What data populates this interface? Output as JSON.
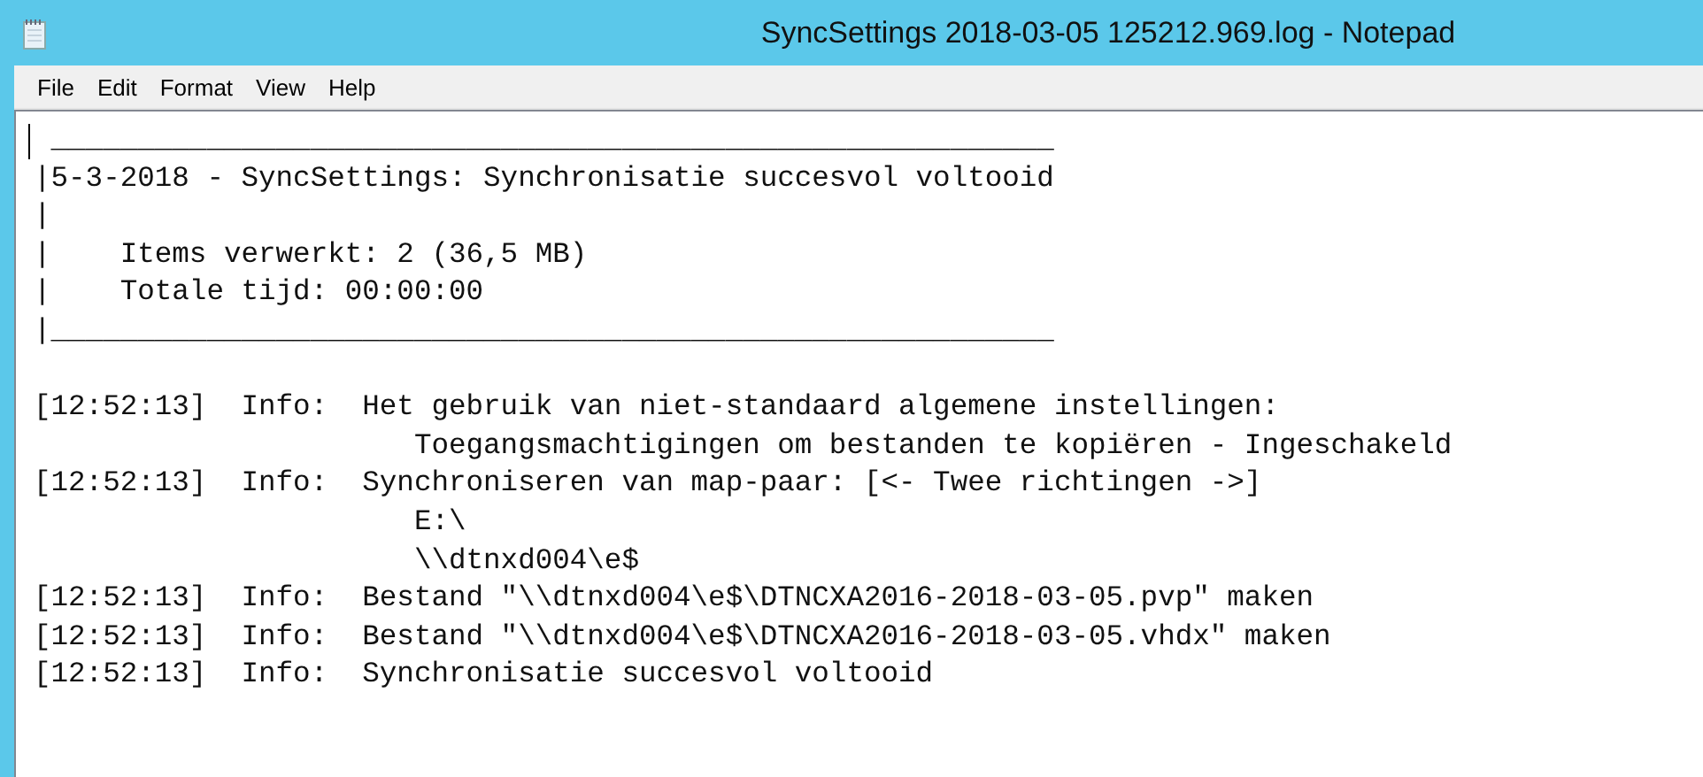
{
  "window": {
    "title": "SyncSettings 2018-03-05 125212.969.log - Notepad"
  },
  "menu": [
    "File",
    "Edit",
    "Format",
    "View",
    "Help"
  ],
  "header_box": [
    " __________________________________________________________",
    "|5-3-2018 - SyncSettings: Synchronisatie succesvol voltooid",
    "|",
    "|    Items verwerkt: 2 (36,5 MB)",
    "|    Totale tijd: 00:00:00",
    "|__________________________________________________________"
  ],
  "log_lines": [
    "[12:52:13]  Info:  Het gebruik van niet-standaard algemene instellingen:",
    "                      Toegangsmachtigingen om bestanden te kopiëren - Ingeschakeld",
    "[12:52:13]  Info:  Synchroniseren van map-paar: [<- Twee richtingen ->]",
    "                      E:\\",
    "                      \\\\dtnxd004\\e$",
    "[12:52:13]  Info:  Bestand \"\\\\dtnxd004\\e$\\DTNCXA2016-2018-03-05.pvp\" maken",
    "[12:52:13]  Info:  Bestand \"\\\\dtnxd004\\e$\\DTNCXA2016-2018-03-05.vhdx\" maken",
    "[12:52:13]  Info:  Synchronisatie succesvol voltooid"
  ]
}
